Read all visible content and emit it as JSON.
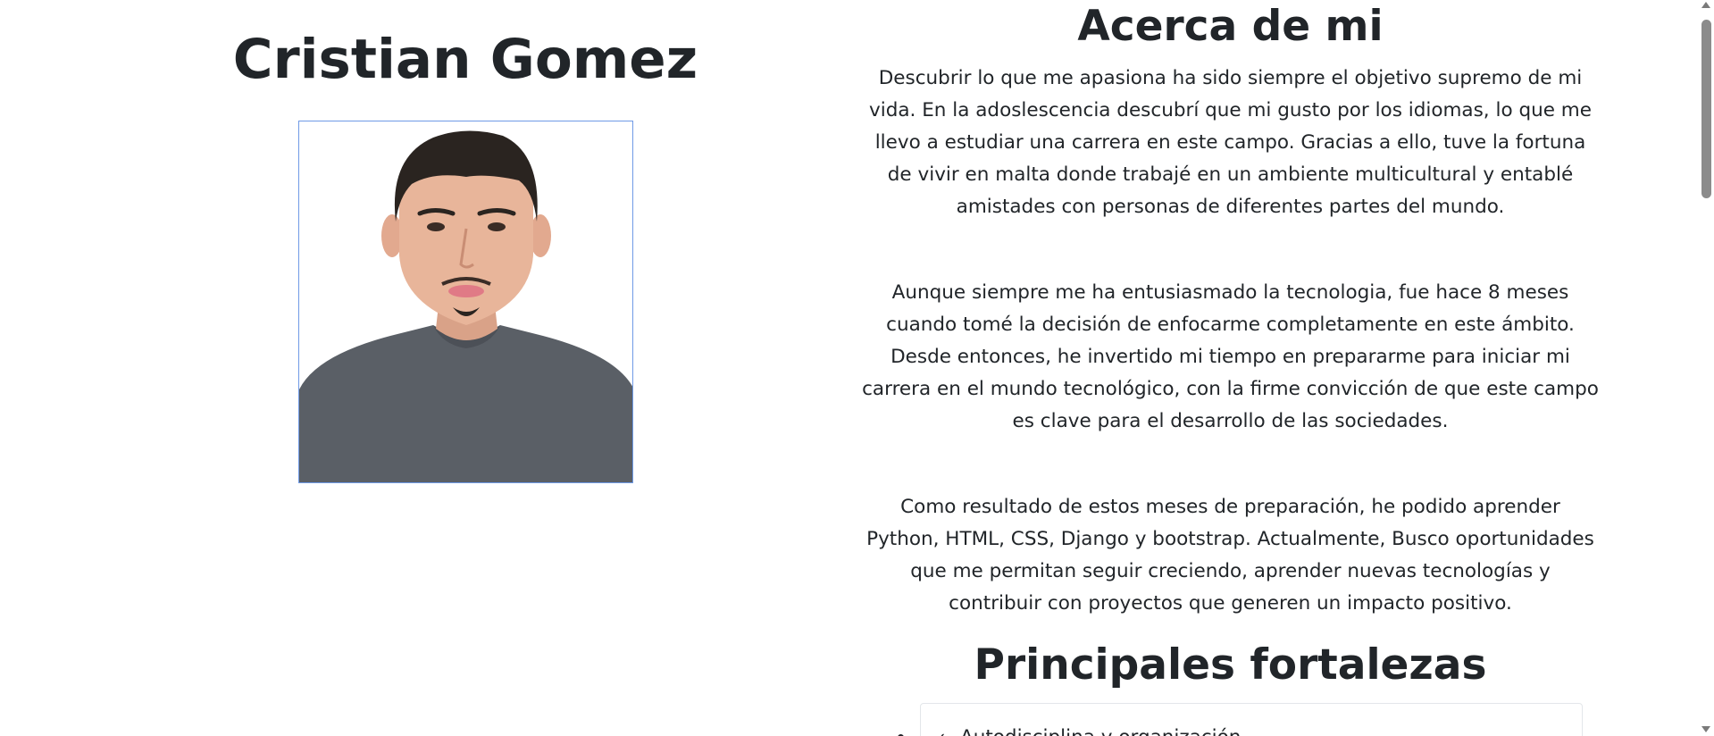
{
  "profile": {
    "name": "Cristian Gomez",
    "photo_alt": "Cristian Gomez portrait"
  },
  "about": {
    "heading": "Acerca de mi",
    "paragraphs": [
      "Descubrir lo que me apasiona ha sido siempre el objetivo supremo de mi vida. En la adoslescencia descubrí que mi gusto por los idiomas, lo que me llevo a estudiar una carrera en este campo. Gracias a ello, tuve la fortuna de vivir en malta donde trabajé en un ambiente multicultural y entablé amistades con personas de diferentes partes del mundo.",
      "Aunque siempre me ha entusiasmado la tecnologia, fue hace 8 meses cuando tomé la decisión de enfocarme completamente en este ámbito. Desde entonces, he invertido mi tiempo en prepararme para iniciar mi carrera en el mundo tecnológico, con la firme convicción de que este campo es clave para el desarrollo de las sociedades.",
      "Como resultado de estos meses de preparación, he podido aprender Python, HTML, CSS, Django y bootstrap. Actualmente, Busco oportunidades que me permitan seguir creciendo, aprender nuevas tecnologías y contribuir con proyectos que generen un impacto positivo."
    ]
  },
  "strengths": {
    "heading": "Principales fortalezas",
    "items": [
      {
        "icon": "check-icon",
        "label": "Autodisciplina y organización"
      }
    ]
  },
  "colors": {
    "text": "#212529",
    "photo_border": "#6f9ae6",
    "shirt": "#5a5f66",
    "skin": "#e8b59a",
    "hair": "#2a2420"
  }
}
